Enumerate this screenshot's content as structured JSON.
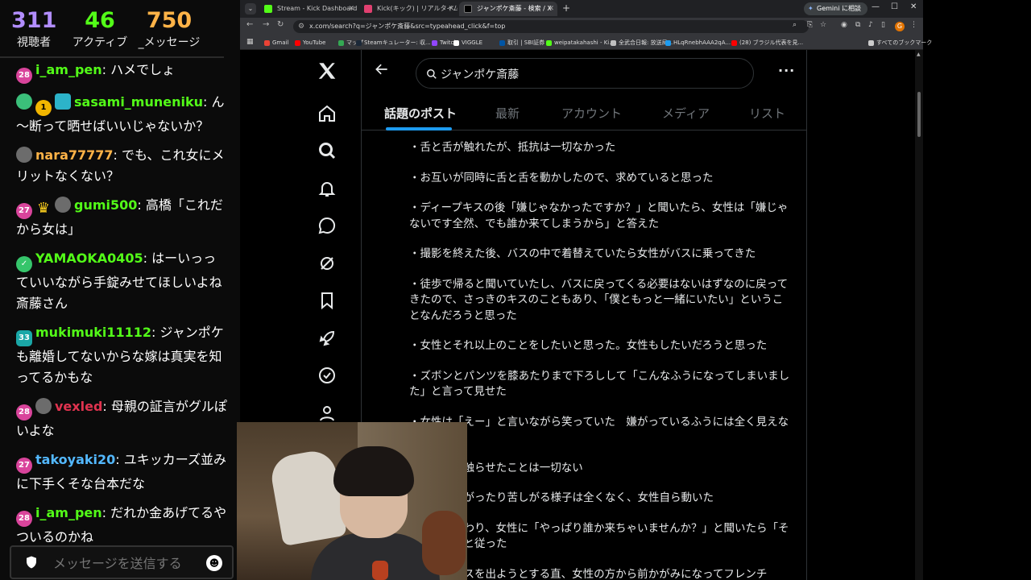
{
  "overlay": {
    "stats": [
      {
        "value": "311",
        "label": "視聴者"
      },
      {
        "value": "46",
        "label": "アクティブ"
      },
      {
        "value": "750",
        "label": "_メッセージ"
      }
    ],
    "messages": [
      {
        "badges": [
          {
            "type": "pink",
            "text": "28"
          }
        ],
        "user": "i_am_pen",
        "user_color": "#53fc18",
        "text": "ハメでしょ"
      },
      {
        "badges": [
          {
            "type": "alien",
            "text": ""
          },
          {
            "type": "gold",
            "text": "1"
          },
          {
            "type": "bar",
            "text": ""
          }
        ],
        "user": "sasami_muneniku",
        "user_color": "#53fc18",
        "text": "ん～断って晒せばいいじゃないか？"
      },
      {
        "badges": [
          {
            "type": "avatar",
            "text": ""
          }
        ],
        "user": "nara77777",
        "user_color": "#ffb347",
        "text": "でも、これ女にメリットなくない？"
      },
      {
        "badges": [
          {
            "type": "pink",
            "text": "27"
          },
          {
            "type": "crown",
            "text": "♛"
          },
          {
            "type": "avatar",
            "text": ""
          }
        ],
        "user": "gumi500",
        "user_color": "#53fc18",
        "text": "高橋「これだから女は」"
      },
      {
        "badges": [
          {
            "type": "green",
            "text": "✓"
          }
        ],
        "user": "YAMAOKA0405",
        "user_color": "#53fc18",
        "text": "はーいっっていいながら手錠みせてほしいよね斎藤さん"
      },
      {
        "badges": [
          {
            "type": "teal",
            "text": "33"
          }
        ],
        "user": "mukimuki11112",
        "user_color": "#53fc18",
        "text": "ジャンポケも離婚してないからな嫁は真実を知ってるかもな"
      },
      {
        "badges": [
          {
            "type": "pink",
            "text": "28"
          },
          {
            "type": "avatar",
            "text": ""
          }
        ],
        "user": "vexled",
        "user_color": "#e0334f",
        "text": "母親の証言がグルぽいよな"
      },
      {
        "badges": [
          {
            "type": "pink",
            "text": "27"
          }
        ],
        "user": "takoyaki20",
        "user_color": "#53b8ff",
        "text": "ユキッカーズ並みに下手くそな台本だな"
      },
      {
        "badges": [
          {
            "type": "pink",
            "text": "28"
          }
        ],
        "user": "i_am_pen",
        "user_color": "#53fc18",
        "text": "だれか金あげてるやついるのかね"
      }
    ],
    "input_placeholder": "メッセージを送信する"
  },
  "browser": {
    "tabs": [
      {
        "title": "Stream - Kick Dashboard",
        "color": "#53fc18"
      },
      {
        "title": "Kick(キック) | リアルタイムランキング",
        "color": "#e04070"
      },
      {
        "title": "ジャンポケ斎藤 - 検索 / X",
        "color": "#000000",
        "active": true
      }
    ],
    "new_tab": "+",
    "gemini_label": "Gemini に相談",
    "url": "x.com/search?q=ジャンポケ斎藤&src=typeahead_click&f=top",
    "profile_initial": "G",
    "bookmarks": [
      {
        "label": "Gmail",
        "color": "#ea4335"
      },
      {
        "label": "YouTube",
        "color": "#ff0000"
      },
      {
        "label": "マップ",
        "color": "#34a853"
      },
      {
        "label": "Steamキュレーター: 収...",
        "color": "#1b2838"
      },
      {
        "label": "Twitch",
        "color": "#9146ff"
      },
      {
        "label": "VIGGLE",
        "color": "#ffffff"
      },
      {
        "label": "取引 | SBI証券",
        "color": "#0055a5"
      },
      {
        "label": "weipatakahashi - Ki...",
        "color": "#53fc18"
      },
      {
        "label": "全武合日報: 放送局...",
        "color": "#c0c0c0"
      },
      {
        "label": "HLqRnebhAAA2qA...",
        "color": "#1d9bf0"
      },
      {
        "label": "(28) ブラジル代表を見...",
        "color": "#ff0000"
      }
    ],
    "all_bookmarks": "すべてのブックマーク"
  },
  "x": {
    "search_value": "ジャンポケ斎藤",
    "tabs": [
      {
        "label": "話題のポスト",
        "active": true
      },
      {
        "label": "最新"
      },
      {
        "label": "アカウント"
      },
      {
        "label": "メディア"
      },
      {
        "label": "リスト"
      }
    ],
    "paragraphs": [
      "・舌と舌が触れたが、抵抗は一切なかった",
      "・お互いが同時に舌と舌を動かしたので、求めていると思った",
      "・ディープキスの後「嫌じゃなかったですか？」と聞いたら、女性は「嫌じゃないです全然、でも誰か来てしまうから」と答えた",
      "・撮影を終えた後、バスの中で着替えていたら女性がバスに乗ってきた",
      "・徒歩で帰ると聞いていたし、バスに戻ってくる必要はないはずなのに戻ってきたので、さっきのキスのこともあり、「僕ともっと一緒にいたい」ということなんだろうと思った",
      "・女性とそれ以上のことをしたいと思った。女性もしたいだろうと思った",
      "・ズボンとパンツを膝あたりまで下ろしして「こんなふうになってしまいました」と言って見せた",
      "・女性は「えー」と言いながら笑っていた　嫌がっているふうには全く見えなかった",
      "・無理やり触らせたことは一切ない",
      "・女性が嫌がったり苦しがる様子は全くなく、女性自ら動いた",
      "・行為は終わり、女性に「やっぱり誰か来ちゃいませんか？」と聞いたら「そうですね」と従った",
      "・女性がバスを出ようとする直、女性の方から前かがみになってフレンチ"
    ]
  }
}
